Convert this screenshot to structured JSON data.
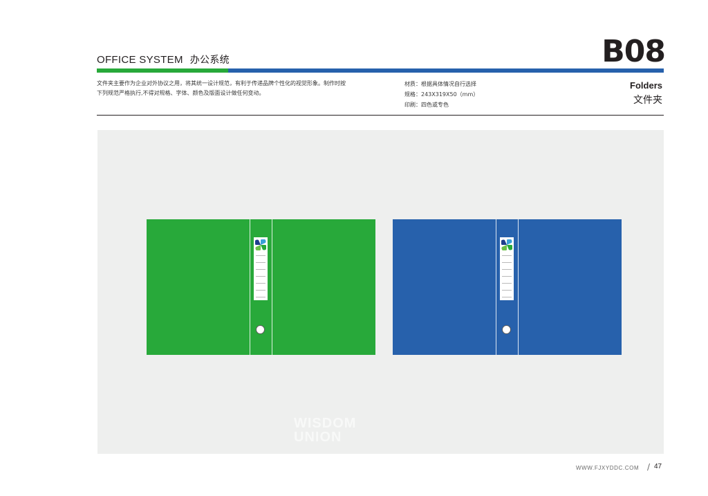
{
  "header": {
    "title_en": "OFFICE SYSTEM",
    "title_cn": "办公系统",
    "code": "B08"
  },
  "description": {
    "line1": "文件夹主要作为企业对外协议之用，将其统一设计规范，有利于传递品牌个性化的视觉形象。制作时按",
    "line2": "下列规范严格执行,不得对规格、字体、颜色及版面设计做任何变动。"
  },
  "specs": {
    "material": "材质：根据具体情况自行选择",
    "size": "规格：243X319X50（mm）",
    "print": "印刷：四色或专色"
  },
  "item": {
    "name_en": "Folders",
    "name_cn": "文件夹"
  },
  "folders": [
    {
      "color_name": "green",
      "color": "#28a93a"
    },
    {
      "color_name": "blue",
      "color": "#2761ac"
    }
  ],
  "brand_colors": {
    "green": "#28a93a",
    "blue": "#2761ac"
  },
  "watermark": {
    "line1": "WISDOM",
    "line2": "UNION"
  },
  "footer": {
    "url": "WWW.FJXYDDC.COM",
    "separator": "/",
    "page": "47"
  },
  "icons": [
    "folder-logo-icon",
    "ring-hole-icon"
  ]
}
